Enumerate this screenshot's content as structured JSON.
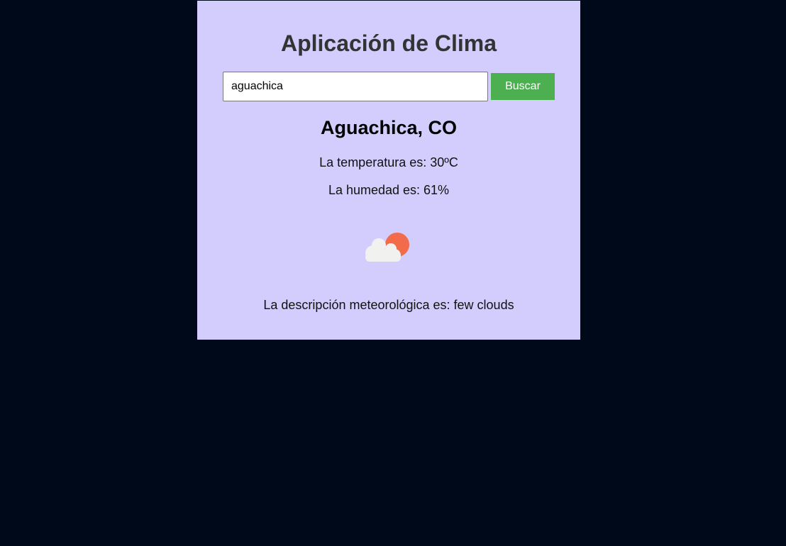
{
  "app": {
    "title": "Aplicación de Clima"
  },
  "search": {
    "value": "aguachica",
    "button_label": "Buscar"
  },
  "weather": {
    "city": "Aguachica, CO",
    "temperature_text": "La temperatura es: 30ºC",
    "humidity_text": "La humedad es: 61%",
    "description_text": "La descripción meteorológica es: few clouds",
    "icon": "few-clouds-icon"
  },
  "colors": {
    "page_background": "#00091a",
    "card_background": "#d2cdfc",
    "button_background": "#4caf50",
    "sun": "#f26b4a",
    "cloud": "#f1f1ef"
  }
}
